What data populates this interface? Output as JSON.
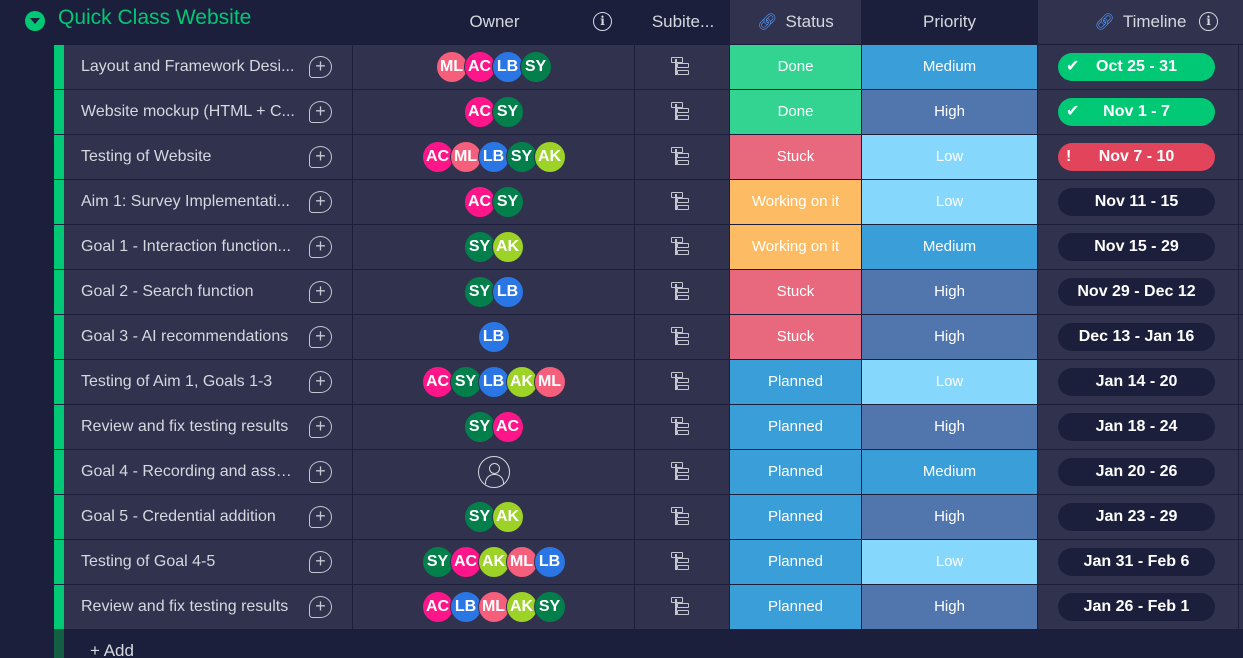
{
  "group": {
    "title": "Quick Class Website",
    "color": "#00c875"
  },
  "columns": {
    "owner": "Owner",
    "subitems": "Subite...",
    "status": "Status",
    "priority": "Priority",
    "timeline": "Timeline"
  },
  "icons": {
    "group_toggle": "chevron-down-icon",
    "info": "info-icon",
    "link": "link-icon",
    "add_update": "add-update-icon",
    "subitems": "subitems-icon",
    "check": "check-icon",
    "alert": "exclamation-icon",
    "person": "person-icon"
  },
  "colors": {
    "status": {
      "Done": "#33d391",
      "Stuck": "#e8697d",
      "Working on it": "#fdbc64",
      "Planned": "#3a9fd8"
    },
    "priority": {
      "Medium": "#3a9fd8",
      "High": "#5176ae",
      "Low": "#86d7fc"
    },
    "timeline_done": "#00c875",
    "timeline_overdue": "#e2445c"
  },
  "rows": [
    {
      "name": "Layout and Framework Desi...",
      "owners": [
        "ML",
        "AC",
        "LB",
        "SY"
      ],
      "status": "Done",
      "priority": "Medium",
      "timeline": "Oct 25 - 31",
      "timeline_state": "done",
      "timeline_mark": "✔"
    },
    {
      "name": "Website mockup (HTML + C...",
      "owners": [
        "AC",
        "SY"
      ],
      "status": "Done",
      "priority": "High",
      "timeline": "Nov 1 - 7",
      "timeline_state": "done",
      "timeline_mark": "✔"
    },
    {
      "name": "Testing of Website",
      "owners": [
        "AC",
        "ML",
        "LB",
        "SY",
        "AK"
      ],
      "status": "Stuck",
      "priority": "Low",
      "timeline": "Nov 7 - 10",
      "timeline_state": "overdue",
      "timeline_mark": "!"
    },
    {
      "name": "Aim 1: Survey Implementati...",
      "owners": [
        "AC",
        "SY"
      ],
      "status": "Working on it",
      "priority": "Low",
      "timeline": "Nov 11 - 15",
      "timeline_state": "normal",
      "timeline_mark": ""
    },
    {
      "name": "Goal 1 - Interaction function...",
      "owners": [
        "SY",
        "AK"
      ],
      "status": "Working on it",
      "priority": "Medium",
      "timeline": "Nov 15 - 29",
      "timeline_state": "normal",
      "timeline_mark": ""
    },
    {
      "name": "Goal 2 - Search function",
      "owners": [
        "SY",
        "LB"
      ],
      "status": "Stuck",
      "priority": "High",
      "timeline": "Nov 29 - Dec 12",
      "timeline_state": "normal",
      "timeline_mark": ""
    },
    {
      "name": "Goal 3 - AI recommendations",
      "owners": [
        "LB"
      ],
      "status": "Stuck",
      "priority": "High",
      "timeline": "Dec 13 - Jan 16",
      "timeline_state": "normal",
      "timeline_mark": ""
    },
    {
      "name": "Testing of Aim 1, Goals 1-3",
      "owners": [
        "AC",
        "SY",
        "LB",
        "AK",
        "ML"
      ],
      "status": "Planned",
      "priority": "Low",
      "timeline": "Jan 14 - 20",
      "timeline_state": "normal",
      "timeline_mark": ""
    },
    {
      "name": "Review and fix testing results",
      "owners": [
        "SY",
        "AC"
      ],
      "status": "Planned",
      "priority": "High",
      "timeline": "Jan 18 - 24",
      "timeline_state": "normal",
      "timeline_mark": ""
    },
    {
      "name": "Goal 4 - Recording and asse...",
      "owners": [],
      "status": "Planned",
      "priority": "Medium",
      "timeline": "Jan 20 - 26",
      "timeline_state": "normal",
      "timeline_mark": ""
    },
    {
      "name": "Goal 5 - Credential addition",
      "owners": [
        "SY",
        "AK"
      ],
      "status": "Planned",
      "priority": "High",
      "timeline": "Jan 23 - 29",
      "timeline_state": "normal",
      "timeline_mark": ""
    },
    {
      "name": "Testing of Goal 4-5",
      "owners": [
        "SY",
        "AC",
        "AK",
        "ML",
        "LB"
      ],
      "status": "Planned",
      "priority": "Low",
      "timeline": "Jan 31 - Feb 6",
      "timeline_state": "normal",
      "timeline_mark": ""
    },
    {
      "name": "Review and fix testing results",
      "owners": [
        "AC",
        "LB",
        "ML",
        "AK",
        "SY"
      ],
      "status": "Planned",
      "priority": "High",
      "timeline": "Jan 26 - Feb 1",
      "timeline_state": "normal",
      "timeline_mark": ""
    }
  ],
  "add_row_label": "+ Add"
}
